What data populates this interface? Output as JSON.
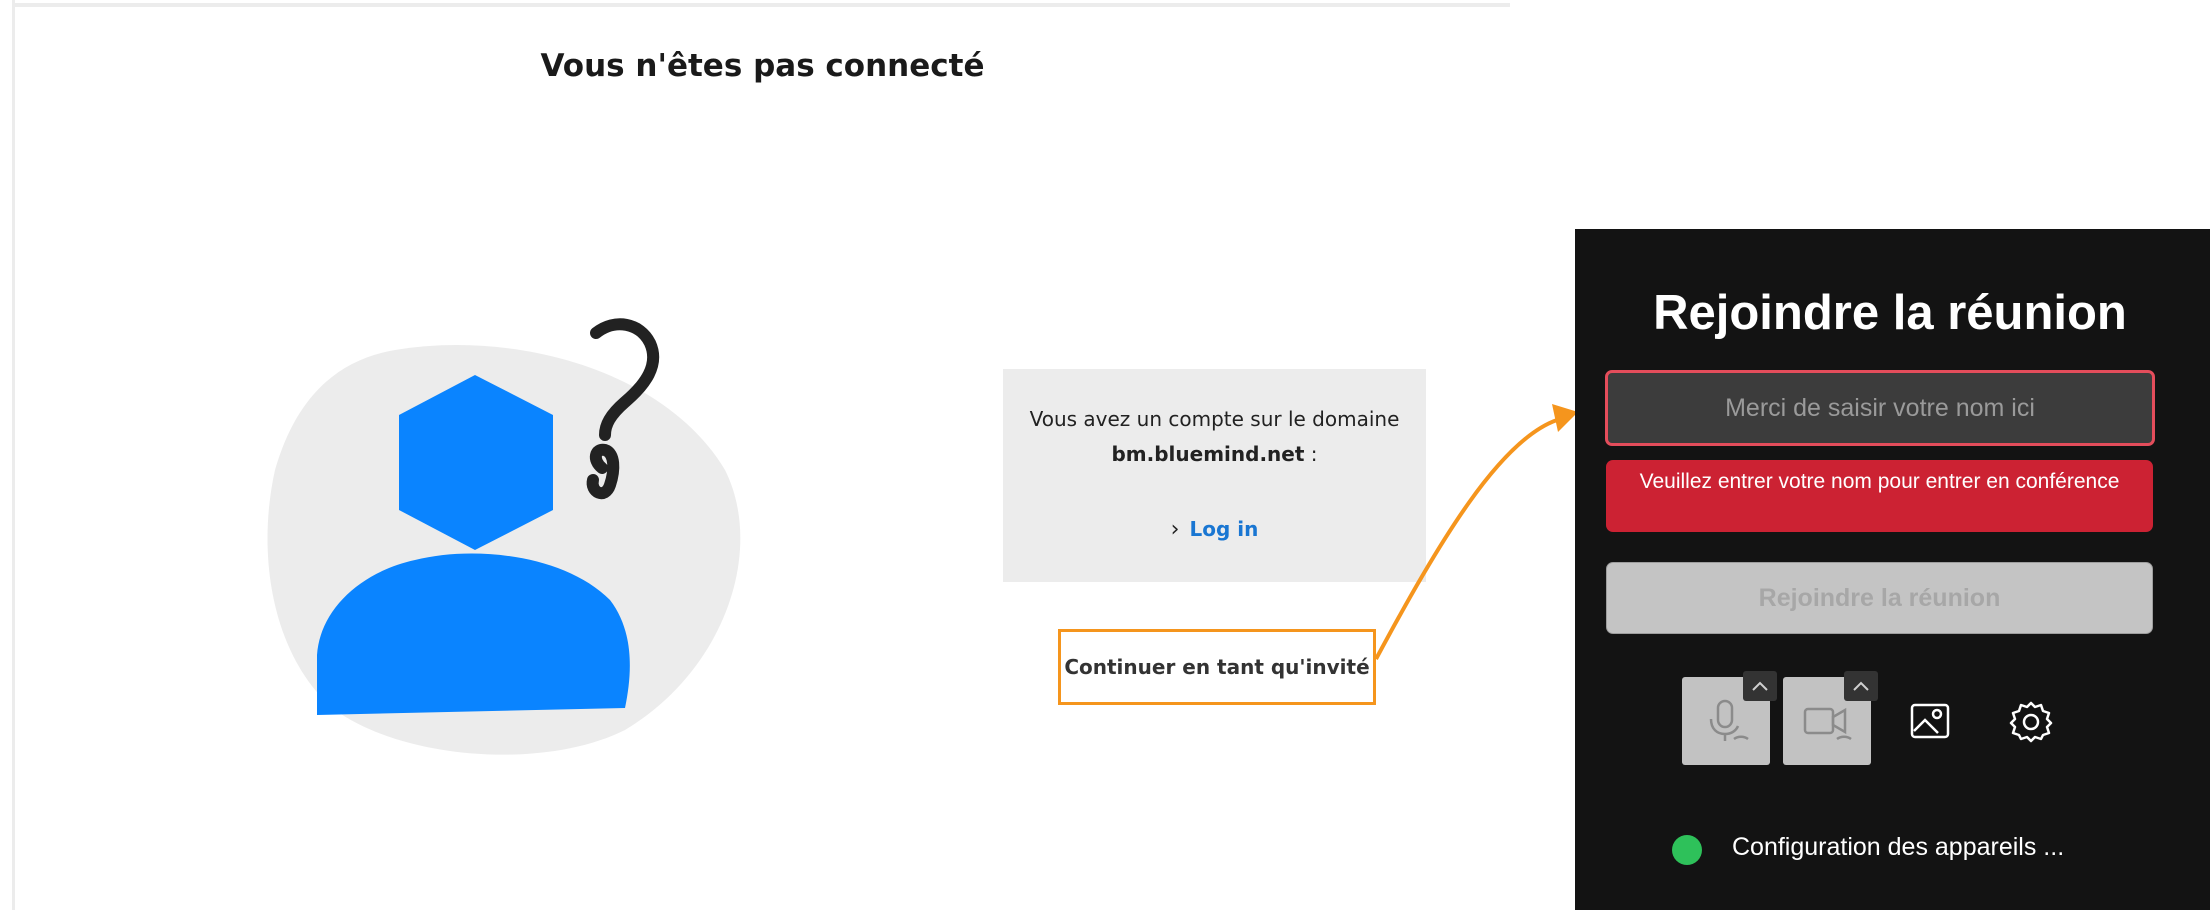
{
  "page": {
    "title": "Vous n'êtes pas connecté"
  },
  "login_card": {
    "line1": "Vous avez un compte sur le domaine",
    "domain": "bm.bluemind.net",
    "domain_suffix": " :",
    "login_label": "Log in"
  },
  "guest": {
    "label": "Continuer en tant qu'invité"
  },
  "panel": {
    "title": "Rejoindre la réunion",
    "name_placeholder": "Merci de saisir votre nom ici",
    "error": "Veuillez entrer votre nom pour entrer en conférence",
    "join_label": "Rejoindre la réunion",
    "status": "Configuration des appareils ..."
  },
  "colors": {
    "accent_orange": "#f5951d",
    "link_blue": "#1976d2",
    "avatar_blue": "#0a84ff",
    "error_red": "#cc2233",
    "status_green": "#2ec15a"
  },
  "icons": {
    "question_mark": "question-mark-icon",
    "chevron": "chevron-right-icon",
    "microphone": "microphone-icon",
    "camera": "camera-icon",
    "background": "image-icon",
    "settings": "gear-icon",
    "caret": "caret-up-icon"
  }
}
